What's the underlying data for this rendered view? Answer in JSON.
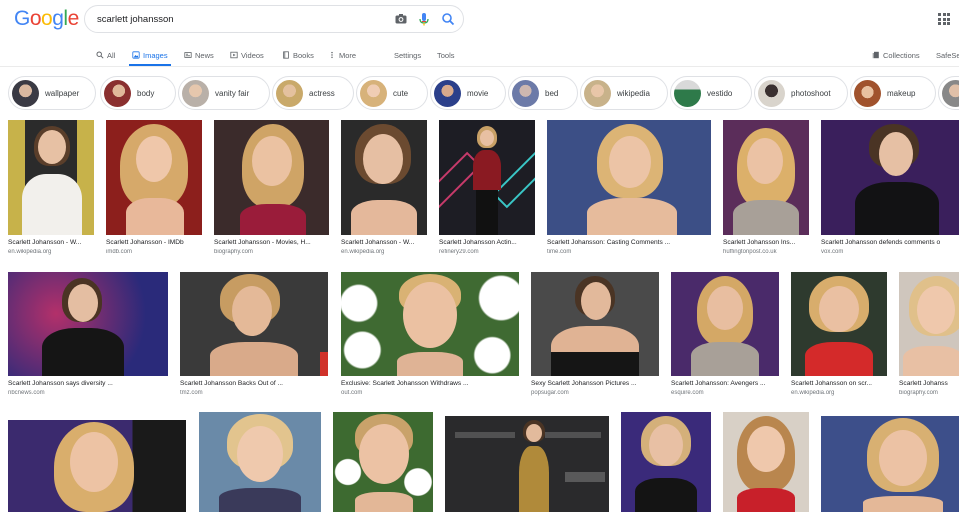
{
  "logo": [
    "G",
    "o",
    "o",
    "g",
    "l",
    "e"
  ],
  "logo_colors": [
    "#4285F4",
    "#EA4335",
    "#FBBC05",
    "#4285F4",
    "#34A853",
    "#EA4335"
  ],
  "search": {
    "value": "scarlett johansson"
  },
  "tabs": {
    "all": "All",
    "images": "Images",
    "news": "News",
    "videos": "Videos",
    "books": "Books",
    "more": "More",
    "settings": "Settings",
    "tools": "Tools",
    "collections": "Collections",
    "safesearch": "SafeSe"
  },
  "chips": [
    "wallpaper",
    "body",
    "vanity fair",
    "actress",
    "cute",
    "movie",
    "bed",
    "wikipedia",
    "vestido",
    "photoshoot",
    "makeup"
  ],
  "row1": [
    {
      "caption": "Scarlett Johansson - W...",
      "source": "en.wikipedia.org"
    },
    {
      "caption": "Scarlett Johansson - IMDb",
      "source": "imdb.com"
    },
    {
      "caption": "Scarlett Johansson - Movies, H...",
      "source": "biography.com"
    },
    {
      "caption": "Scarlett Johansson - W...",
      "source": "en.wikipedia.org"
    },
    {
      "caption": "Scarlett Johansson Actin...",
      "source": "refinery29.com"
    },
    {
      "caption": "Scarlett Johansson: Casting Comments ...",
      "source": "time.com"
    },
    {
      "caption": "Scarlett Johansson Ins...",
      "source": "huffingtonpost.co.uk"
    },
    {
      "caption": "Scarlett Johansson defends comments o",
      "source": "vox.com"
    }
  ],
  "row2": [
    {
      "caption": "Scarlett Johansson says diversity ...",
      "source": "nbcnews.com"
    },
    {
      "caption": "Scarlett Johansson Backs Out of ...",
      "source": "tmz.com"
    },
    {
      "caption": "Exclusive: Scarlett Johansson Withdraws ...",
      "source": "out.com"
    },
    {
      "caption": "Sexy Scarlett Johansson Pictures ...",
      "source": "popsugar.com"
    },
    {
      "caption": "Scarlett Johansson: Avengers ...",
      "source": "esquire.com"
    },
    {
      "caption": "Scarlett Johansson on scr...",
      "source": "en.wikipedia.org"
    },
    {
      "caption": "Scarlett Johanss",
      "source": "biography.com"
    }
  ],
  "colors": {
    "accent": "#1a73e8",
    "muted": "#5f6368",
    "border": "#dfe1e5"
  }
}
